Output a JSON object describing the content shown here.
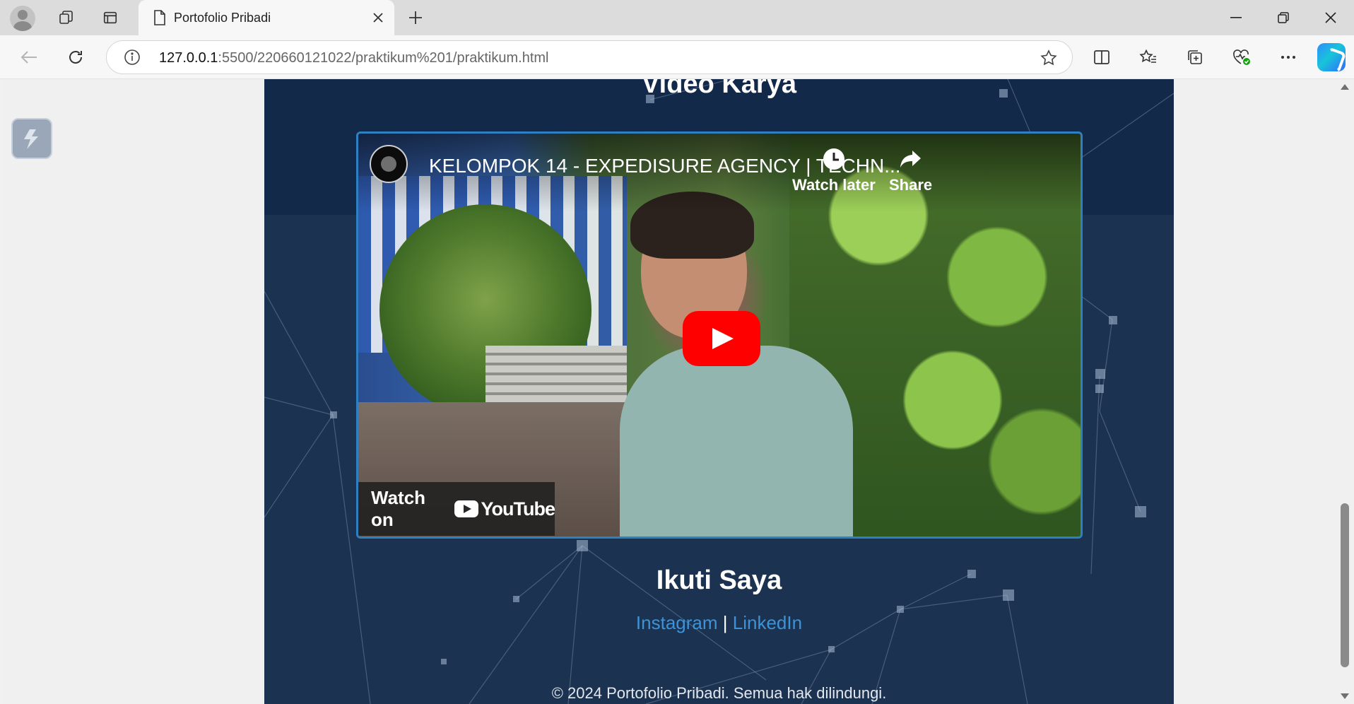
{
  "browser": {
    "tab": {
      "title": "Portofolio Pribadi"
    },
    "address": {
      "host": "127.0.0.1",
      "rest": ":5500/220660121022/praktikum%201/praktikum.html"
    }
  },
  "page": {
    "video_section_title": "Video Karya",
    "video": {
      "title": "KELOMPOK 14 - EXPEDISURE AGENCY | TECHN...",
      "watch_later_label": "Watch later",
      "share_label": "Share",
      "watch_on_label": "Watch on",
      "youtube_label": "YouTube"
    },
    "follow_title": "Ikuti Saya",
    "links": {
      "instagram": "Instagram",
      "separator": "|",
      "linkedin": "LinkedIn"
    },
    "footer": "© 2024 Portofolio Pribadi. Semua hak dilindungi."
  },
  "colors": {
    "page_bg": "#1b3250",
    "link": "#3d93d8",
    "video_border": "#2f80c2",
    "play_red": "#ff0000"
  },
  "icons": [
    "profile-avatar-icon",
    "workspaces-icon",
    "tab-actions-icon",
    "page-icon",
    "close-icon",
    "plus-icon",
    "minimize-icon",
    "restore-icon",
    "back-icon",
    "refresh-icon",
    "info-icon",
    "star-icon",
    "split-screen-icon",
    "favorites-icon",
    "collections-icon",
    "browser-essentials-icon",
    "more-icon",
    "copilot-icon",
    "clock-icon",
    "share-icon",
    "play-icon"
  ]
}
